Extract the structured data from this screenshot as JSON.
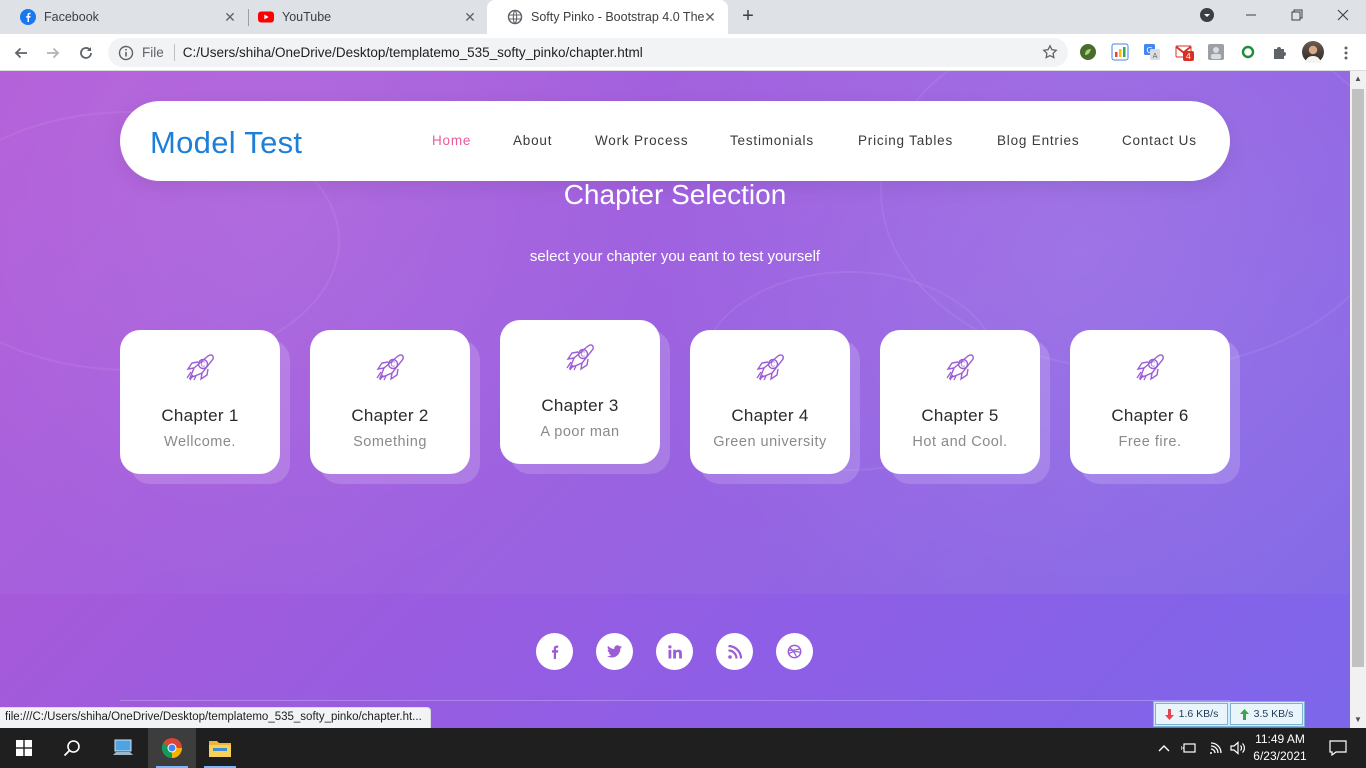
{
  "browser": {
    "tabs": [
      {
        "title": "Facebook"
      },
      {
        "title": "YouTube"
      },
      {
        "title": "Softy Pinko - Bootstrap 4.0 Them"
      }
    ],
    "address_scheme": "File",
    "address_url": "C:/Users/shiha/OneDrive/Desktop/templatemo_535_softy_pinko/chapter.html",
    "gmail_badge": "4",
    "status_url": "file:///C:/Users/shiha/OneDrive/Desktop/templatemo_535_softy_pinko/chapter.ht..."
  },
  "page": {
    "brand": "Model Test",
    "nav": [
      {
        "label": "Home",
        "active": true
      },
      {
        "label": "About"
      },
      {
        "label": "Work Process"
      },
      {
        "label": "Testimonials"
      },
      {
        "label": "Pricing Tables"
      },
      {
        "label": "Blog Entries"
      },
      {
        "label": "Contact Us"
      }
    ],
    "title": "Chapter Selection",
    "subtitle": "select your chapter you eant to test yourself",
    "chapters": [
      {
        "title": "Chapter 1",
        "desc": "Wellcome."
      },
      {
        "title": "Chapter 2",
        "desc": "Something"
      },
      {
        "title": "Chapter 3",
        "desc": "A poor man"
      },
      {
        "title": "Chapter 4",
        "desc": "Green university"
      },
      {
        "title": "Chapter 5",
        "desc": "Hot and Cool."
      },
      {
        "title": "Chapter 6",
        "desc": "Free fire."
      }
    ],
    "social": [
      "facebook-icon",
      "twitter-icon",
      "linkedin-icon",
      "rss-icon",
      "dribbble-icon"
    ]
  },
  "net_meter": {
    "down": "1.6 KB/s",
    "up": "3.5 KB/s"
  },
  "taskbar": {
    "time": "11:49 AM",
    "date": "6/23/2021"
  },
  "colors": {
    "accent_pink": "#e95d9b",
    "brand_blue": "#1e7fd9",
    "purple_start": "#b45fd8",
    "purple_end": "#7f6ae8"
  }
}
